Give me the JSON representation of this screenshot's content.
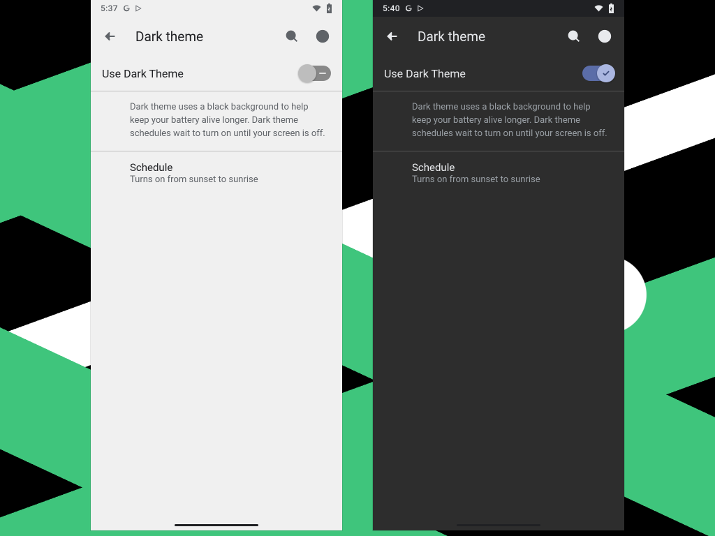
{
  "left": {
    "time": "5:37",
    "title": "Dark theme",
    "toggle_label": "Use Dark Theme",
    "toggle_on": false,
    "description": "Dark theme uses a black background to help keep your battery alive longer. Dark theme schedules wait to turn on until your screen is off.",
    "schedule_label": "Schedule",
    "schedule_value": "Turns on from sunset to sunrise"
  },
  "right": {
    "time": "5:40",
    "title": "Dark theme",
    "toggle_label": "Use Dark Theme",
    "toggle_on": true,
    "description": "Dark theme uses a black background to help keep your battery alive longer. Dark theme schedules wait to turn on until your screen is off.",
    "schedule_label": "Schedule",
    "schedule_value": "Turns on from sunset to sunrise"
  },
  "status_icons": [
    "google-icon",
    "play-icon",
    "wifi-icon",
    "battery-icon"
  ]
}
